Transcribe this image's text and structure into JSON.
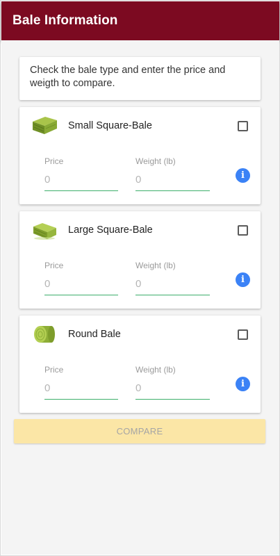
{
  "appbar": {
    "title": "Bale Information"
  },
  "intro": {
    "text": "Check the bale type and enter the price and weigth to compare."
  },
  "bales": [
    {
      "name": "Small Square-Bale",
      "icon": "small-square-bale-icon",
      "price_label": "Price",
      "price_placeholder": "0",
      "weight_label": "Weight (lb)",
      "weight_placeholder": "0",
      "checked": false
    },
    {
      "name": "Large Square-Bale",
      "icon": "large-square-bale-icon",
      "price_label": "Price",
      "price_placeholder": "0",
      "weight_label": "Weight (lb)",
      "weight_placeholder": "0",
      "checked": false
    },
    {
      "name": "Round Bale",
      "icon": "round-bale-icon",
      "price_label": "Price",
      "price_placeholder": "0",
      "weight_label": "Weight (lb)",
      "weight_placeholder": "0",
      "checked": false
    }
  ],
  "info_icon": {
    "glyph": "i"
  },
  "compare_button": {
    "label": "COMPARE"
  },
  "colors": {
    "appbar": "#7c0a21",
    "input_underline": "#3cae6a",
    "info": "#3b82f6",
    "compare_bg": "#fbe6a6"
  }
}
